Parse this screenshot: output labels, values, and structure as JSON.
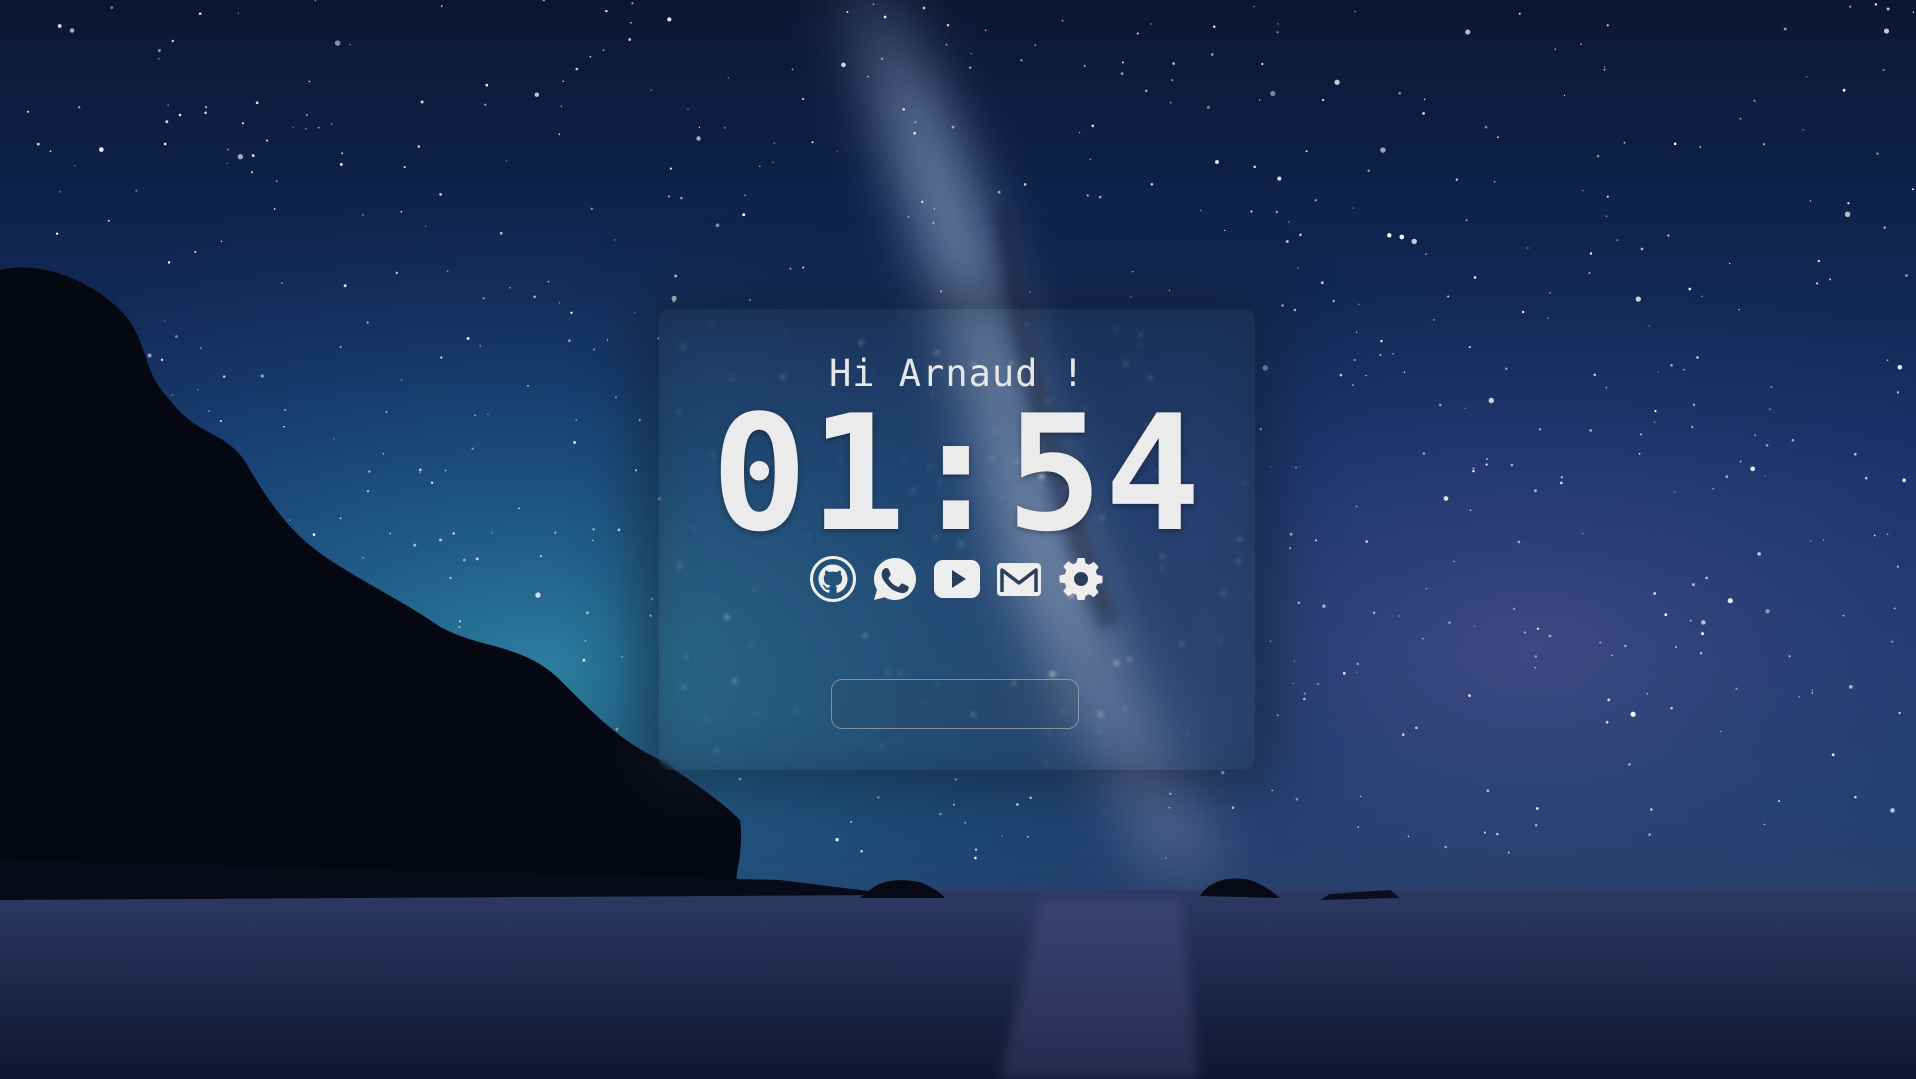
{
  "greeting": "Hi Arnaud !",
  "clock": "01:54",
  "shortcuts": [
    {
      "icon": "github-icon"
    },
    {
      "icon": "whatsapp-icon"
    },
    {
      "icon": "youtube-icon"
    },
    {
      "icon": "gmail-icon"
    },
    {
      "icon": "gear-icon"
    }
  ],
  "search": {
    "value": "",
    "placeholder": ""
  },
  "colors": {
    "text": "#ebebeb",
    "sky_top": "#0b1633",
    "sky_glow": "#2f7ea6",
    "milky_way": "#9fb4d8"
  }
}
